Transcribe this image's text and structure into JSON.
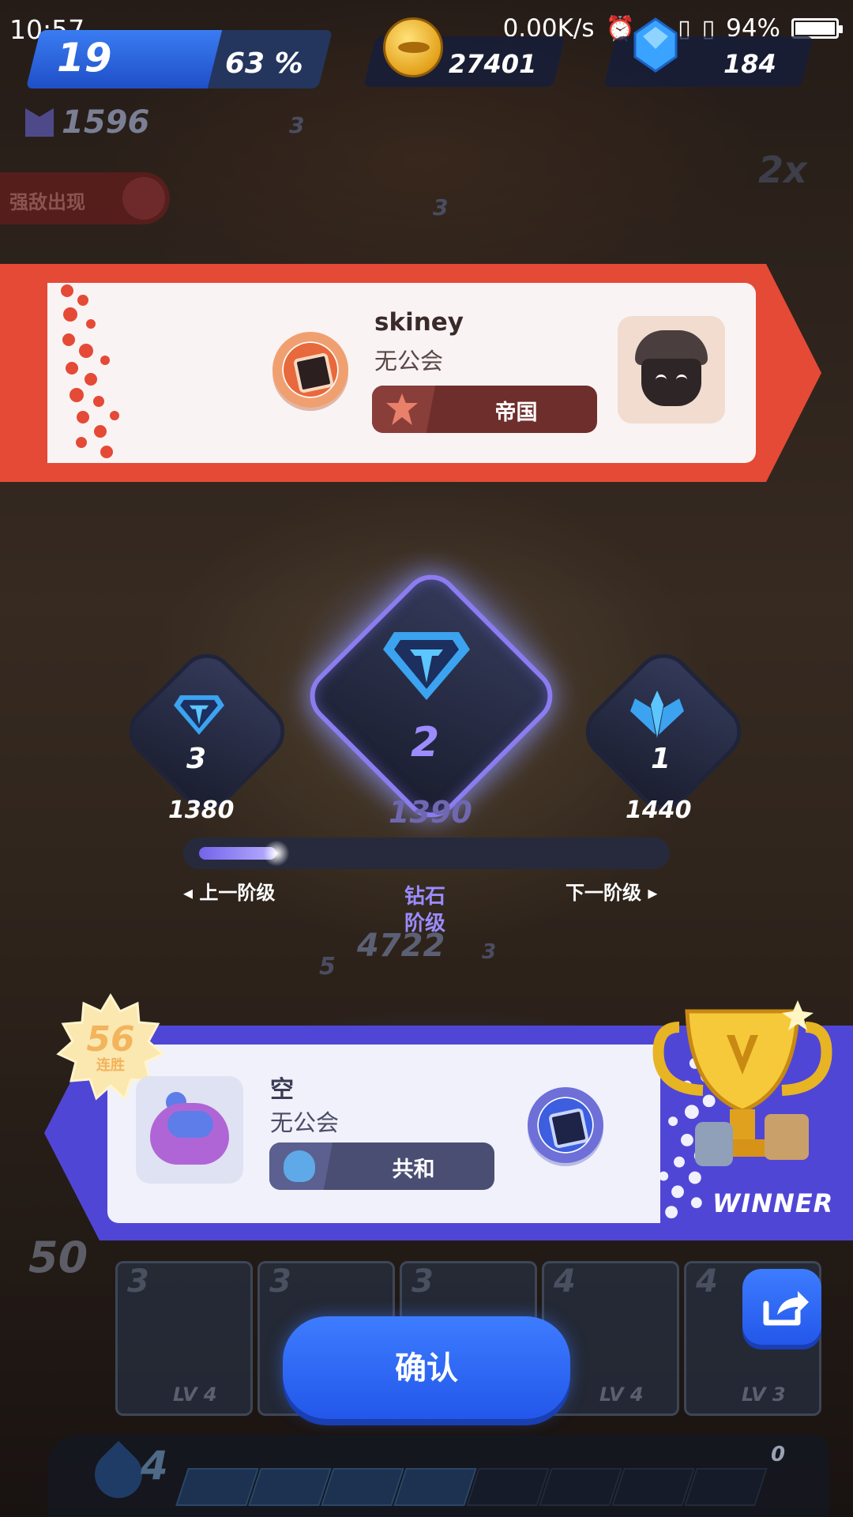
{
  "status_bar": {
    "time": "10:57",
    "network": "0.00K/s",
    "battery": "94%"
  },
  "hud": {
    "level": "19",
    "level_progress": "63 %",
    "level_progress_value": 63,
    "coins": "27401",
    "gems": "184",
    "trophies": "1596",
    "enemy_banner": "强敌出现",
    "speed": "2x"
  },
  "opponent": {
    "name": "skiney",
    "guild": "无公会",
    "faction": "帝国",
    "faction_icon": "empire-star-icon",
    "color": "#e44a36"
  },
  "rank": {
    "center_tier": "2",
    "left_tier": "3",
    "right_tier": "1",
    "left_score": "1380",
    "center_score": "1390",
    "right_score": "1440",
    "progress_fraction": 0.17,
    "prev_label": "上一阶级",
    "next_label": "下一阶级",
    "tier_name": "钻石阶级",
    "accent": "#8b7df0"
  },
  "background_text": {
    "hp": "4722",
    "unit_level_a": "5",
    "unit_level_b": "3",
    "unit_level_c": "3",
    "unit_level_d": "3",
    "side_number": "50"
  },
  "player": {
    "name": "空",
    "guild": "无公会",
    "faction": "共和",
    "faction_icon": "republic-helmet-icon",
    "win_streak": "56",
    "win_streak_label": "连胜",
    "result_label": "WINNER",
    "color": "#5046d6"
  },
  "deck": {
    "cards": [
      {
        "cost": "3",
        "level": "LV 4"
      },
      {
        "cost": "3",
        "level": ""
      },
      {
        "cost": "3",
        "level": ""
      },
      {
        "cost": "4",
        "level": "LV 4"
      },
      {
        "cost": "4",
        "level": "LV 3"
      }
    ],
    "energy": "4",
    "elixir_count": "0",
    "energy_segments": 8,
    "energy_filled": 4
  },
  "buttons": {
    "confirm": "确认",
    "share_icon": "share-icon"
  }
}
